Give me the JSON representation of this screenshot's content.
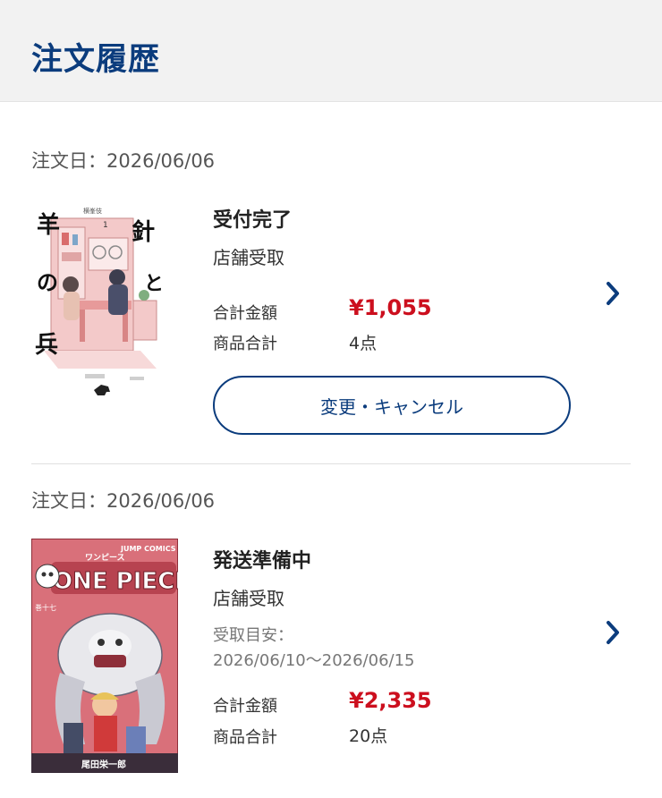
{
  "header": {
    "title": "注文履歴"
  },
  "orders": [
    {
      "date_label": "注文日：2026/06/06",
      "status": "受付完了",
      "pickup": "店舗受取",
      "total_label": "合計金額",
      "total": "¥1,055",
      "count_label": "商品合計",
      "count": "4点",
      "action_label": "変更・キャンセル",
      "cover": {
        "title_chars": [
          "羊",
          "の",
          "兵",
          "針",
          "と"
        ],
        "volume": "1",
        "author": "横峯伎"
      }
    },
    {
      "date_label": "注文日：2026/06/06",
      "status": "発送準備中",
      "pickup": "店舗受取",
      "eta_label": "受取目安：",
      "eta_range": "2026/06/10〜2026/06/15",
      "total_label": "合計金額",
      "total": "¥2,335",
      "count_label": "商品合計",
      "count": "20点",
      "cover": {
        "series": "ONE PIECE",
        "series_kana": "ワンピース",
        "imprint": "JUMP COMICS",
        "volume": "巻十七",
        "author": "尾田栄一郎"
      }
    }
  ],
  "icons": {
    "chevron": "chevron-right-icon"
  },
  "colors": {
    "brand": "#0b3c7d",
    "price": "#cc0f1e",
    "header_bg": "#f2f2f2"
  }
}
